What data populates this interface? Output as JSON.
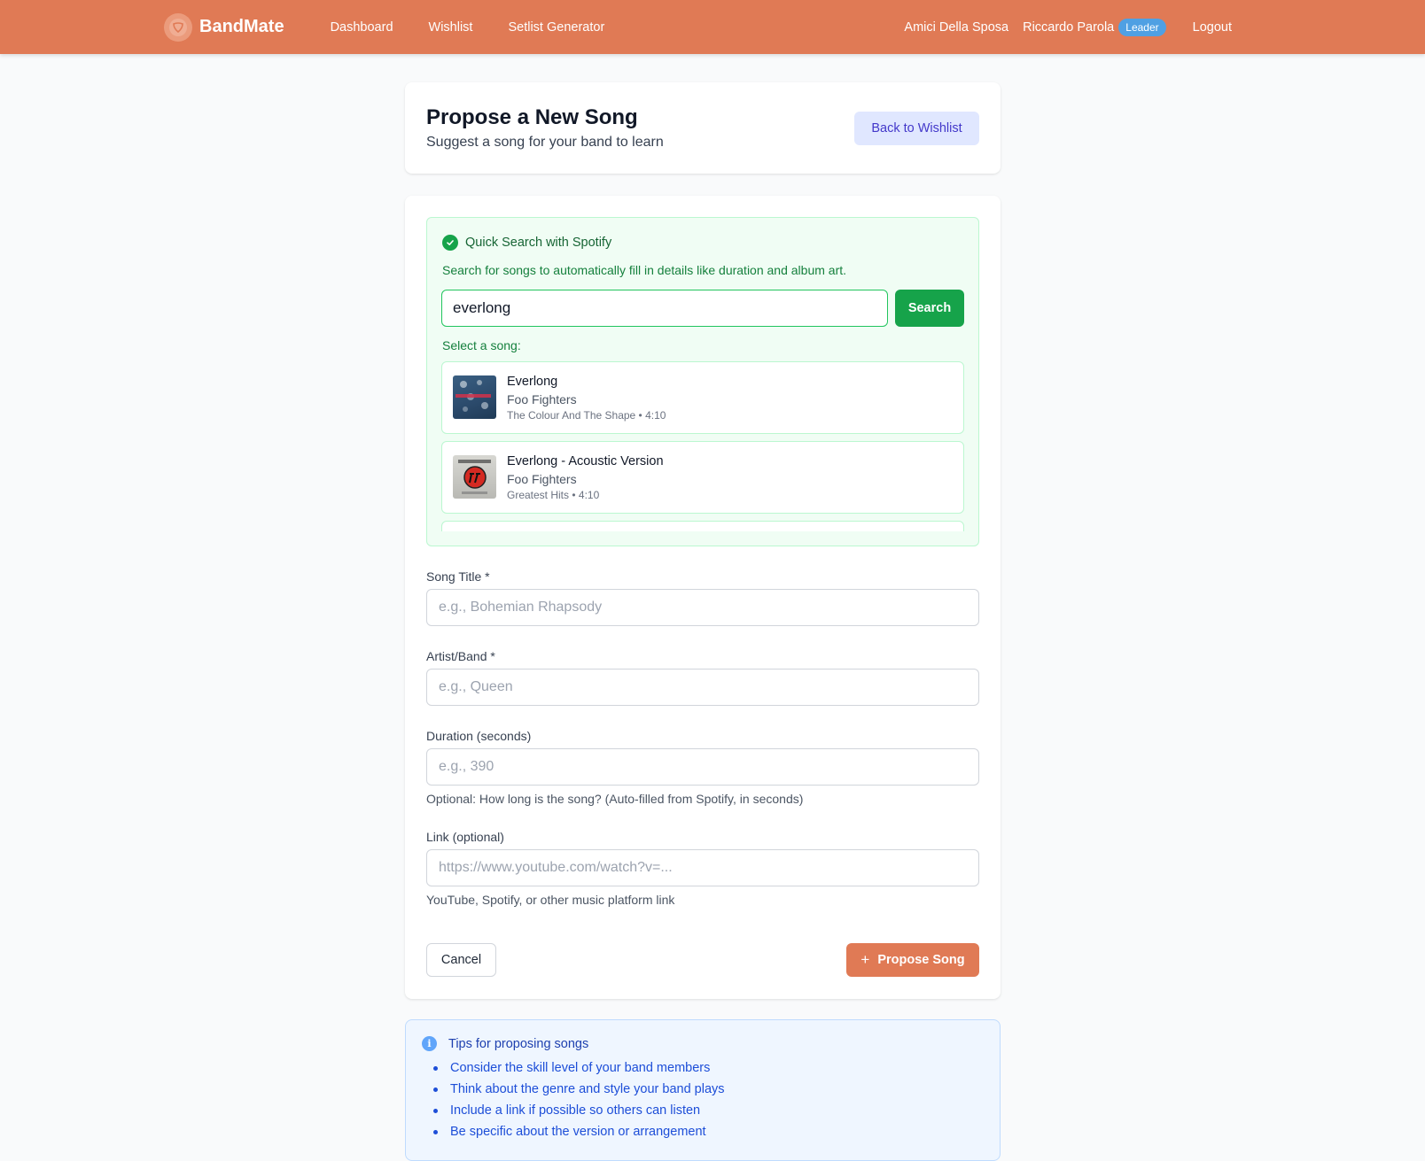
{
  "nav": {
    "brand": "BandMate",
    "links": [
      "Dashboard",
      "Wishlist",
      "Setlist Generator"
    ],
    "band_name": "Amici Della Sposa",
    "user_name": "Riccardo Parola",
    "role_badge": "Leader",
    "logout": "Logout"
  },
  "header": {
    "title": "Propose a New Song",
    "subtitle": "Suggest a song for your band to learn",
    "back_button": "Back to Wishlist"
  },
  "spotify": {
    "title": "Quick Search with Spotify",
    "description": "Search for songs to automatically fill in details like duration and album art.",
    "query": "everlong",
    "search_button": "Search",
    "select_label": "Select a song:",
    "results": [
      {
        "title": "Everlong",
        "artist": "Foo Fighters",
        "meta": "The Colour And The Shape • 4:10"
      },
      {
        "title": "Everlong - Acoustic Version",
        "artist": "Foo Fighters",
        "meta": "Greatest Hits • 4:10"
      }
    ]
  },
  "form": {
    "title_label": "Song Title *",
    "title_placeholder": "e.g., Bohemian Rhapsody",
    "title_value": "",
    "artist_label": "Artist/Band *",
    "artist_placeholder": "e.g., Queen",
    "artist_value": "",
    "duration_label": "Duration (seconds)",
    "duration_placeholder": "e.g., 390",
    "duration_value": "",
    "duration_help": "Optional: How long is the song? (Auto-filled from Spotify, in seconds)",
    "link_label": "Link (optional)",
    "link_placeholder": "https://www.youtube.com/watch?v=...",
    "link_value": "",
    "link_help": "YouTube, Spotify, or other music platform link",
    "cancel_button": "Cancel",
    "submit_button": "Propose Song"
  },
  "tips": {
    "title": "Tips for proposing songs",
    "items": [
      "Consider the skill level of your band members",
      "Think about the genre and style your band plays",
      "Include a link if possible so others can listen",
      "Be specific about the version or arrangement"
    ]
  },
  "colors": {
    "brand": "#e07a55",
    "spotify_green": "#16a34a",
    "info_blue": "#1d4ed8"
  }
}
